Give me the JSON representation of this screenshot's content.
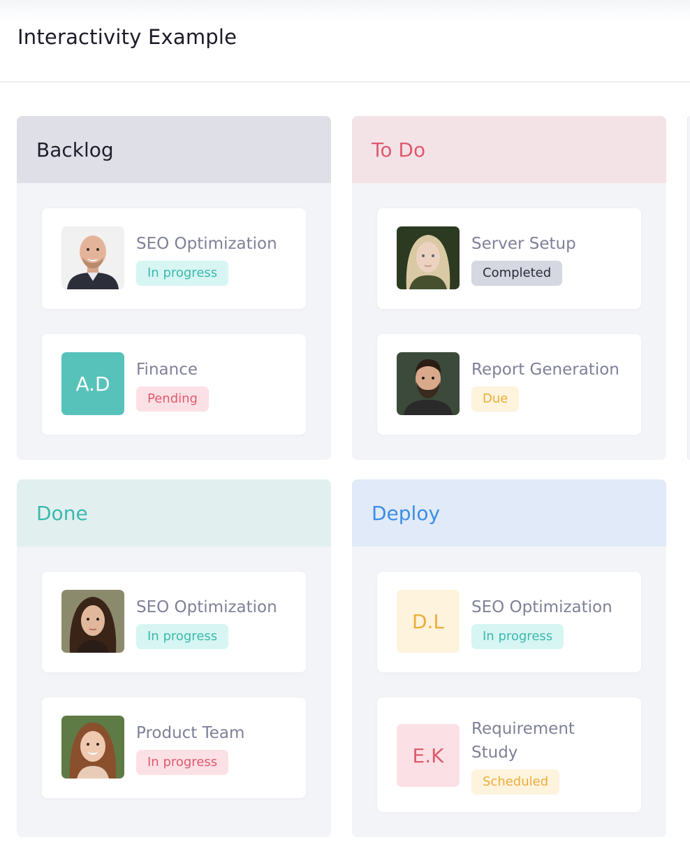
{
  "page": {
    "title": "Interactivity Example"
  },
  "colors": {
    "backlog_header": "#dfe0e7",
    "todo_header": "#f4e3e6",
    "done_header": "#e1f0ef",
    "deploy_header": "#e1eaf8",
    "todo_title": "#e05a6e",
    "done_title": "#3ab9ae",
    "deploy_title": "#3b8ee6"
  },
  "columns": [
    {
      "title": "Backlog",
      "cards": [
        {
          "title": "SEO Optimization",
          "status": "In progress",
          "avatar": "photo-bald-smiling-man"
        },
        {
          "title": "Finance",
          "status": "Pending",
          "avatar_initials": "A.D"
        }
      ]
    },
    {
      "title": "To Do",
      "cards": [
        {
          "title": "Server Setup",
          "status": "Completed",
          "avatar": "photo-blonde-woman"
        },
        {
          "title": "Report Generation",
          "status": "Due",
          "avatar": "photo-bearded-man"
        }
      ]
    },
    {
      "title": "Done",
      "cards": [
        {
          "title": "SEO Optimization",
          "status": "In progress",
          "avatar": "photo-dark-haired-woman"
        },
        {
          "title": "Product Team",
          "status": "In progress",
          "avatar": "photo-smiling-woman"
        }
      ]
    },
    {
      "title": "Deploy",
      "cards": [
        {
          "title": "SEO Optimization",
          "status": "In progress",
          "avatar_initials": "D.L"
        },
        {
          "title": "Requirement Study",
          "status": "Scheduled",
          "avatar_initials": "E.K"
        }
      ]
    }
  ]
}
